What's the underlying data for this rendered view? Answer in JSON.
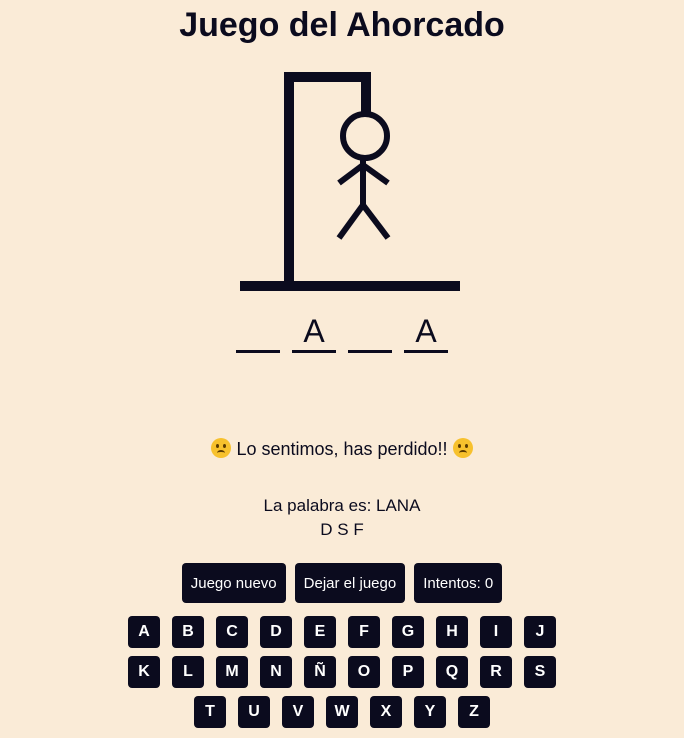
{
  "title": "Juego del Ahorcado",
  "word_slots": [
    "",
    "A",
    "",
    "A"
  ],
  "message": {
    "text": "Lo sentimos, has perdido!!",
    "icon": "sad-tear-emoji"
  },
  "reveal": {
    "word_line": "La palabra es: LANA",
    "wrong_letters": "D S F"
  },
  "controls": {
    "new_game": "Juego nuevo",
    "quit": "Dejar el juego",
    "attempts": "Intentos: 0"
  },
  "keyboard": {
    "row1": [
      "A",
      "B",
      "C",
      "D",
      "E",
      "F",
      "G",
      "H",
      "I",
      "J"
    ],
    "row2": [
      "K",
      "L",
      "M",
      "N",
      "Ñ",
      "O",
      "P",
      "Q",
      "R",
      "S"
    ],
    "row3": [
      "T",
      "U",
      "V",
      "W",
      "X",
      "Y",
      "Z"
    ]
  },
  "colors": {
    "background": "#faebd7",
    "ink": "#0b0b1e",
    "button_text": "#ffffff"
  }
}
